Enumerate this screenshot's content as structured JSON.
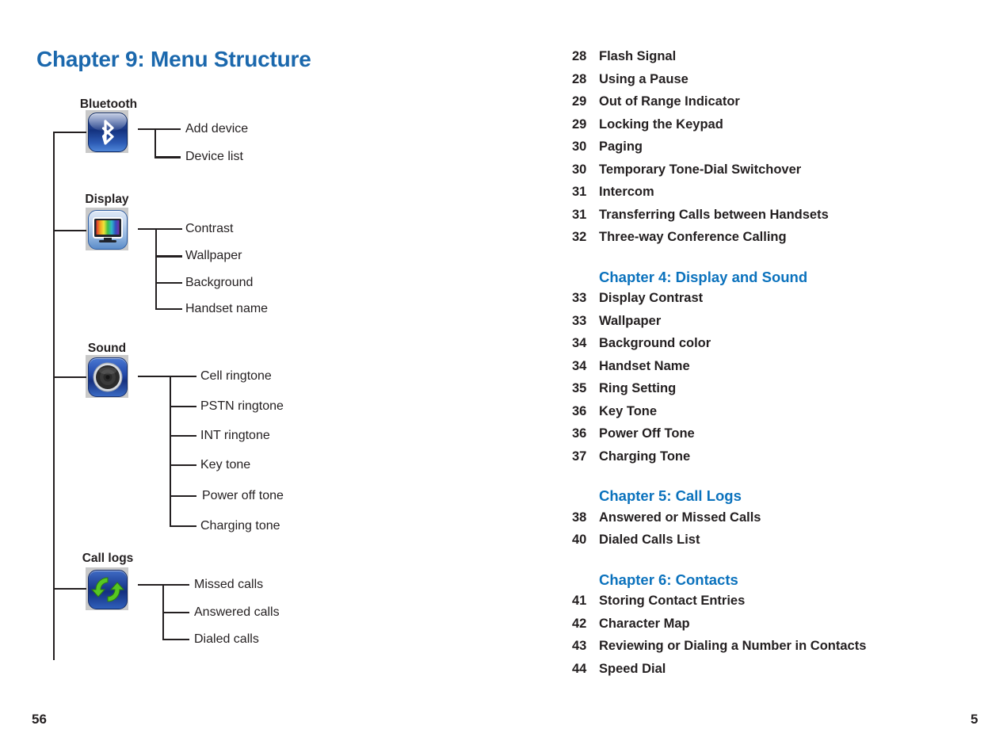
{
  "document": {
    "title": "Chapter 9: Menu Structure",
    "title_color": "#1b68ad",
    "heading_color": "#0b72bd",
    "text_color": "#231f20",
    "folio_left": "56",
    "folio_right": "5"
  },
  "menu_tree": {
    "groups": [
      {
        "label": "Bluetooth",
        "icon": "bluetooth-icon",
        "children": [
          "Add device",
          "Device list"
        ]
      },
      {
        "label": "Display",
        "icon": "display-icon",
        "children": [
          "Contrast",
          "Wallpaper",
          "Background",
          "Handset name"
        ]
      },
      {
        "label": "Sound",
        "icon": "sound-icon",
        "children": [
          "Cell ringtone",
          "PSTN ringtone",
          "INT ringtone",
          "Key tone",
          "Power off tone",
          "Charging tone"
        ]
      },
      {
        "label": "Call logs",
        "icon": "call-logs-icon",
        "children": [
          "Missed calls",
          "Answered calls",
          "Dialed calls"
        ]
      }
    ]
  },
  "toc": {
    "blocks": [
      {
        "heading": null,
        "entries": [
          {
            "page": "28",
            "title": "Flash Signal"
          },
          {
            "page": "28",
            "title": "Using a Pause"
          },
          {
            "page": "29",
            "title": "Out of Range Indicator"
          },
          {
            "page": "29",
            "title": "Locking the Keypad"
          },
          {
            "page": "30",
            "title": "Paging"
          },
          {
            "page": "30",
            "title": "Temporary Tone-Dial Switchover"
          },
          {
            "page": "31",
            "title": "Intercom"
          },
          {
            "page": "31",
            "title": "Transferring Calls between Handsets"
          },
          {
            "page": "32",
            "title": "Three-way Conference Calling"
          }
        ]
      },
      {
        "heading": "Chapter 4: Display and Sound",
        "entries": [
          {
            "page": "33",
            "title": "Display Contrast"
          },
          {
            "page": "33",
            "title": "Wallpaper"
          },
          {
            "page": "34",
            "title": "Background color"
          },
          {
            "page": "34",
            "title": "Handset Name"
          },
          {
            "page": "35",
            "title": "Ring Setting"
          },
          {
            "page": "36",
            "title": "Key Tone"
          },
          {
            "page": "36",
            "title": "Power Off Tone"
          },
          {
            "page": "37",
            "title": "Charging Tone"
          }
        ]
      },
      {
        "heading": "Chapter 5: Call Logs",
        "entries": [
          {
            "page": "38",
            "title": "Answered or Missed Calls"
          },
          {
            "page": "40",
            "title": "Dialed Calls List"
          }
        ]
      },
      {
        "heading": "Chapter 6: Contacts",
        "entries": [
          {
            "page": "41",
            "title": "Storing Contact Entries"
          },
          {
            "page": "42",
            "title": "Character Map"
          },
          {
            "page": "43",
            "title": "Reviewing or Dialing a Number in Contacts"
          },
          {
            "page": "44",
            "title": "Speed Dial"
          }
        ]
      }
    ]
  }
}
